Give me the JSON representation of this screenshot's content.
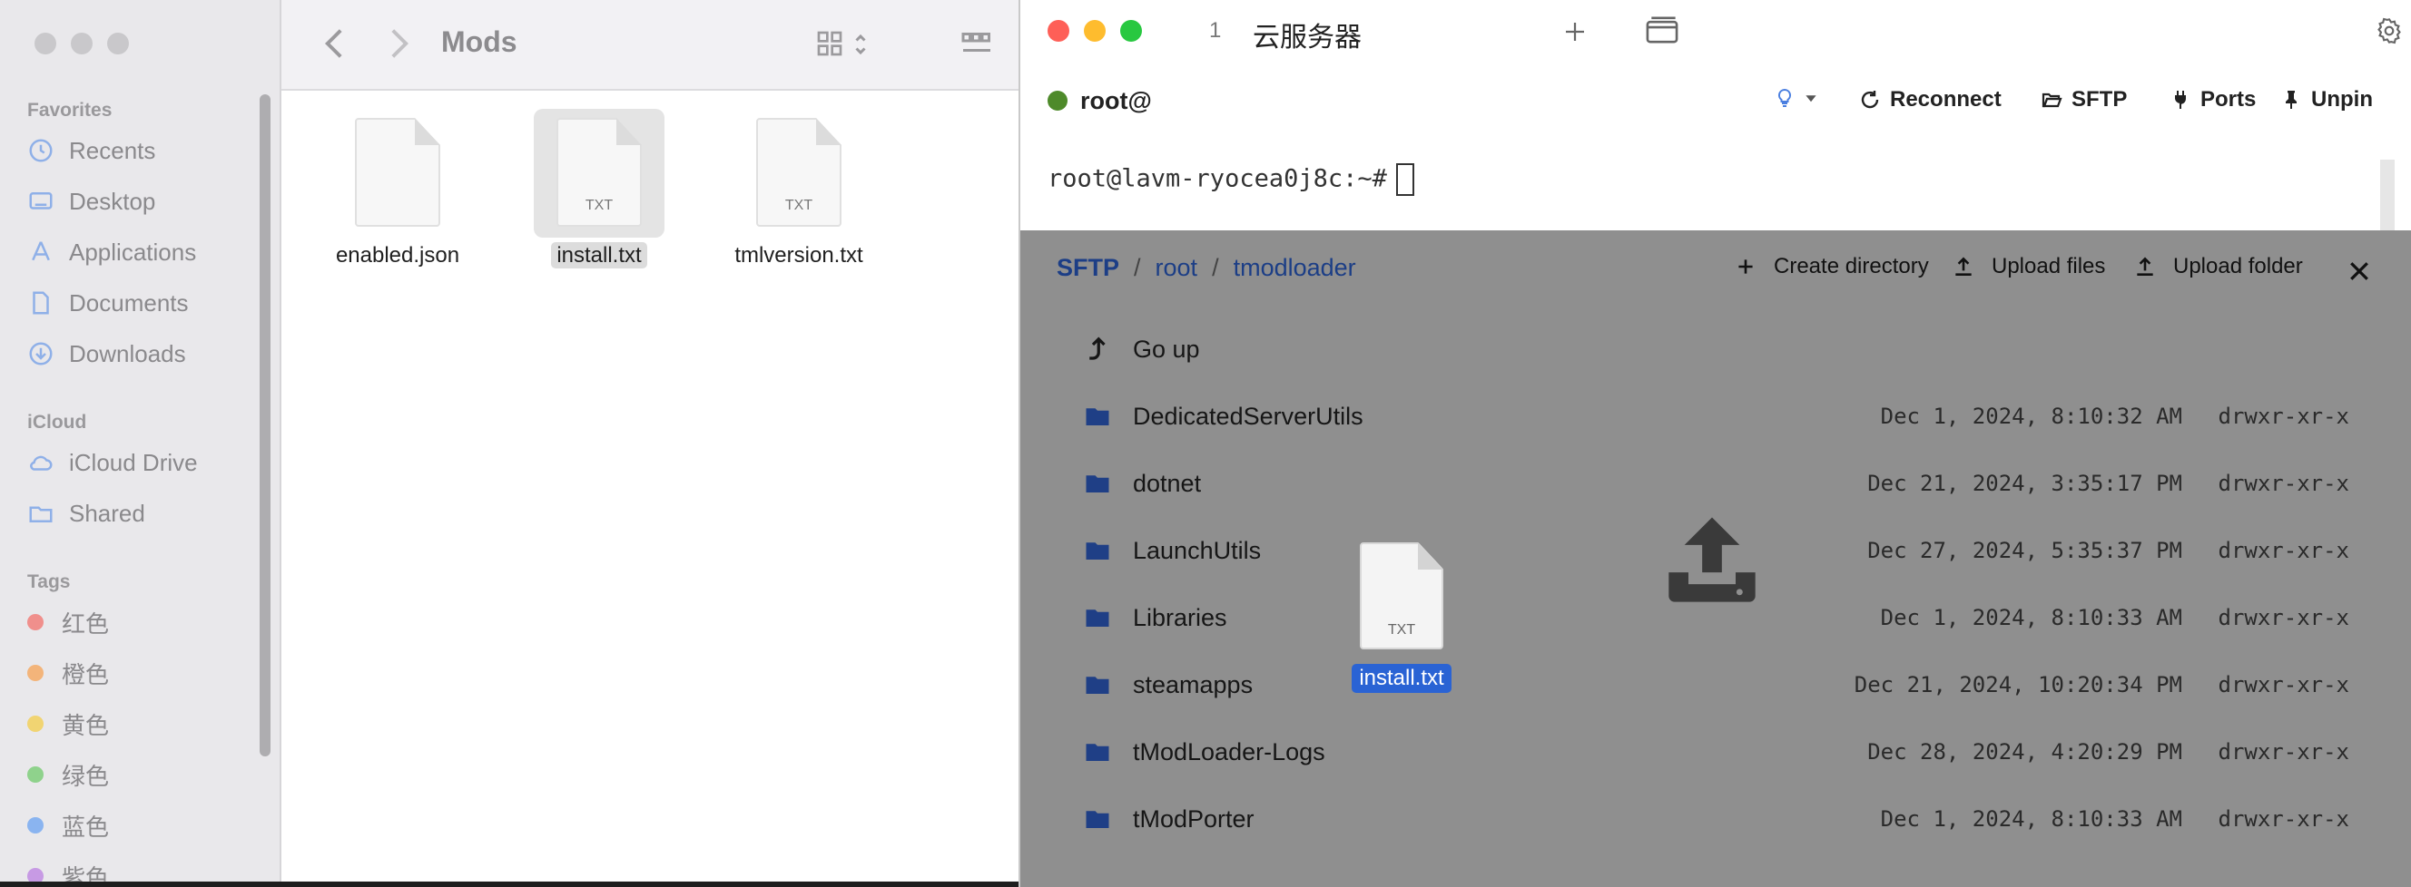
{
  "finder": {
    "title": "Mods",
    "sidebar": {
      "favorites_heading": "Favorites",
      "favorites": [
        {
          "label": "Recents",
          "icon": "clock-icon"
        },
        {
          "label": "Desktop",
          "icon": "desktop-icon"
        },
        {
          "label": "Applications",
          "icon": "applications-icon"
        },
        {
          "label": "Documents",
          "icon": "document-icon"
        },
        {
          "label": "Downloads",
          "icon": "download-icon"
        }
      ],
      "icloud_heading": "iCloud",
      "icloud": [
        {
          "label": "iCloud Drive",
          "icon": "cloud-icon"
        },
        {
          "label": "Shared",
          "icon": "shared-folder-icon"
        }
      ],
      "tags_heading": "Tags",
      "tags": [
        {
          "label": "红色",
          "color": "#f08f8c"
        },
        {
          "label": "橙色",
          "color": "#f3b47a"
        },
        {
          "label": "黄色",
          "color": "#f1d472"
        },
        {
          "label": "绿色",
          "color": "#8fd28c"
        },
        {
          "label": "蓝色",
          "color": "#8ab4f0"
        },
        {
          "label": "紫色",
          "color": "#c79ae4"
        }
      ]
    },
    "files": [
      {
        "name": "enabled.json",
        "ext": ""
      },
      {
        "name": "install.txt",
        "ext": "TXT"
      },
      {
        "name": "tmlversion.txt",
        "ext": "TXT"
      }
    ]
  },
  "terminal": {
    "tab_index": "1",
    "tab_title": "云服务器",
    "connection_label": "root@",
    "buttons": {
      "reconnect": "Reconnect",
      "sftp": "SFTP",
      "ports": "Ports",
      "unpin": "Unpin"
    },
    "prompt": "root@lavm-ryocea0j8c:~#",
    "status_color": "#4e8a2a"
  },
  "sftp": {
    "breadcrumb": [
      "SFTP",
      "root",
      "tmodloader"
    ],
    "buttons": {
      "create_directory": "Create directory",
      "upload_files": "Upload files",
      "upload_folder": "Upload folder"
    },
    "go_up": "Go up",
    "entries": [
      {
        "name": "DedicatedServerUtils",
        "date": "Dec 1, 2024, 8:10:32 AM",
        "perm": "drwxr-xr-x"
      },
      {
        "name": "dotnet",
        "date": "Dec 21, 2024, 3:35:17 PM",
        "perm": "drwxr-xr-x"
      },
      {
        "name": "LaunchUtils",
        "date": "Dec 27, 2024, 5:35:37 PM",
        "perm": "drwxr-xr-x"
      },
      {
        "name": "Libraries",
        "date": "Dec 1, 2024, 8:10:33 AM",
        "perm": "drwxr-xr-x"
      },
      {
        "name": "steamapps",
        "date": "Dec 21, 2024, 10:20:34 PM",
        "perm": "drwxr-xr-x"
      },
      {
        "name": "tModLoader-Logs",
        "date": "Dec 28, 2024, 4:20:29 PM",
        "perm": "drwxr-xr-x"
      },
      {
        "name": "tModPorter",
        "date": "Dec 1, 2024, 8:10:33 AM",
        "perm": "drwxr-xr-x"
      }
    ]
  },
  "drag": {
    "file_name": "install.txt",
    "ext": "TXT"
  }
}
